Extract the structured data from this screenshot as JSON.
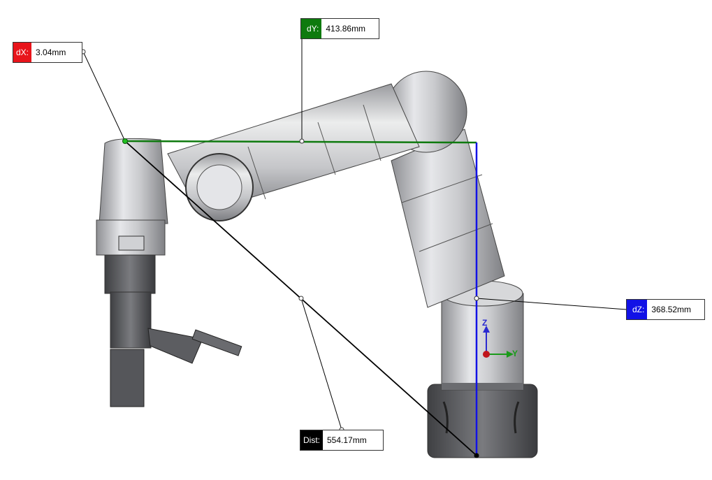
{
  "measurements": {
    "dx": {
      "label": "dX:",
      "value": "3.04mm",
      "color": "#e8141b"
    },
    "dy": {
      "label": "dY:",
      "value": "413.86mm",
      "color": "#0e7a0e"
    },
    "dz": {
      "label": "dZ:",
      "value": "368.52mm",
      "color": "#1212e6"
    },
    "dist": {
      "label": "Dist:",
      "value": "554.17mm",
      "color": "#000000"
    }
  },
  "triad": {
    "z_label": "Z",
    "y_label": "Y",
    "z_color": "#2a2ad0",
    "y_color": "#1a9a1a",
    "origin_color": "#c0141b"
  },
  "model": {
    "body_color": "#c8c9cc",
    "dark_color": "#5a5b5e"
  }
}
